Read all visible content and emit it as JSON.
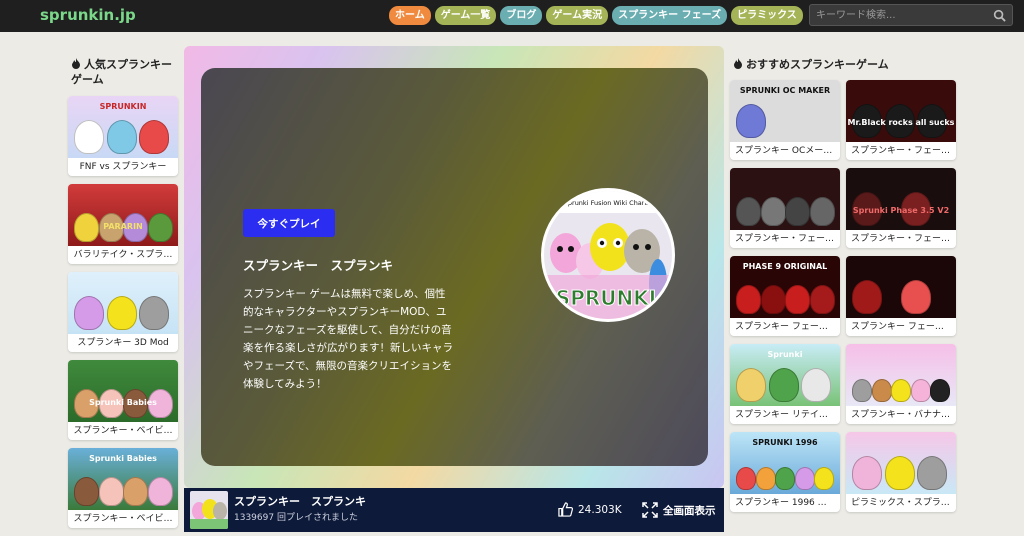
{
  "site": {
    "logo": "sprunkin.jp"
  },
  "nav": [
    {
      "label": "ホーム",
      "color": "#f08a3e"
    },
    {
      "label": "ゲーム一覧",
      "color": "#a5b457"
    },
    {
      "label": "ブログ",
      "color": "#6aaeb1"
    },
    {
      "label": "ゲーム実況",
      "color": "#a5b457"
    },
    {
      "label": "スプランキー フェーズ",
      "color": "#6aaeb1"
    },
    {
      "label": "ピラミックス",
      "color": "#a5b457"
    }
  ],
  "search": {
    "placeholder": "キーワード検索..."
  },
  "left": {
    "title_line1": "人気スプランキー",
    "title_line2": "ゲーム",
    "cards": [
      {
        "label": "FNF vs スプランキー",
        "thumb_text": "SPRUNKIN"
      },
      {
        "label": "バラリテイク・スプラ…",
        "thumb_text": "PARARIN"
      },
      {
        "label": "スプランキー 3D Mod",
        "thumb_text": ""
      },
      {
        "label": "スプランキー・ベイビ…",
        "thumb_text": "Sprunki Babies"
      },
      {
        "label": "スプランキー・ベイビ…",
        "thumb_text": "Sprunki Babies"
      }
    ]
  },
  "right": {
    "title": "おすすめスプランキーゲーム",
    "cards": [
      {
        "label": "スプランキー OCメー…",
        "thumb_text": "SPRUNKI OC MAKER"
      },
      {
        "label": "スプランキー・フェー…",
        "thumb_text": "Mr.Black rocks all sucks"
      },
      {
        "label": "スプランキー・フェー…",
        "thumb_text": ""
      },
      {
        "label": "スプランキー・フェー…",
        "thumb_text": "Sprunki Phase 3.5 V2"
      },
      {
        "label": "スプランキー フェー…",
        "thumb_text": "PHASE 9 ORIGINAL"
      },
      {
        "label": "スプランキー フェー…",
        "thumb_text": ""
      },
      {
        "label": "スプランキー リテイ…",
        "thumb_text": "Sprunki"
      },
      {
        "label": "スプランキー・バナナ…",
        "thumb_text": ""
      },
      {
        "label": "スプランキー 1996 【…",
        "thumb_text": "SPRUNKI 1996"
      },
      {
        "label": "ピラミックス・スプラ…",
        "thumb_text": ""
      }
    ]
  },
  "game": {
    "play_label": "今すぐプレイ",
    "title": "スプランキー　スプランキ",
    "description": "スプランキー ゲームは無料で楽しめ、個性的なキャラクターやスプランキーMOD、ユニークなフェーズを駆使して、自分だけの音楽を作る楽しさが広がります！新しいキャラやフェーズで、無限の音楽クリエイションを体験してみよう！",
    "disc_text": "SPRUNKI",
    "disc_top_text": "but Sprunki Fusion Wiki Characte…"
  },
  "info": {
    "title": "スプランキー　スプランキ",
    "plays": "1339697 回プレイされました",
    "likes": "24.303K",
    "fullscreen": "全画面表示"
  }
}
